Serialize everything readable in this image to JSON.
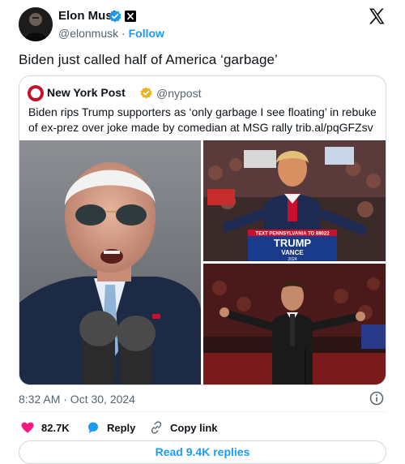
{
  "author": {
    "name": "Elon Musk",
    "handle": "@elonmusk",
    "separator": " · ",
    "follow_label": "Follow"
  },
  "tweet": {
    "text": "Biden just called half of America ‘garbage’",
    "timestamp": "8:32 AM · Oct 30, 2024"
  },
  "quote": {
    "name": "New York Post",
    "handle": "@nypost",
    "text": "Biden rips Trump supporters as ‘only garbage I see floating’ in rebuke of ex-prez over joke made by comedian at MSG rally trib.al/pqGFZsv",
    "images": {
      "top_right_sign_banner": "TEXT PENNSYLVANIA TO 88022",
      "top_right_sign_line1": "TRUMP",
      "top_right_sign_line2": "VANCE",
      "top_right_sign_year": "2024"
    }
  },
  "actions": {
    "likes_count": "82.7K",
    "reply_label": "Reply",
    "copy_link_label": "Copy link"
  },
  "replies_button": "Read 9.4K replies",
  "colors": {
    "accent": "#1d9bf0",
    "like": "#f91880",
    "muted": "#536471",
    "nypost_red": "#c8102e"
  },
  "icons": [
    "verified-badge-icon",
    "x-logo-icon",
    "info-icon",
    "heart-icon",
    "reply-bubble-icon",
    "link-icon"
  ]
}
